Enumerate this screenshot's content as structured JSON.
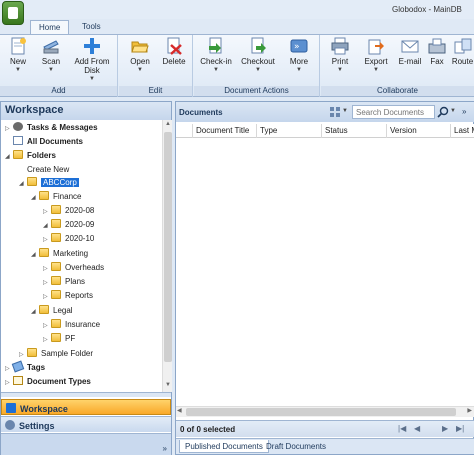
{
  "app": {
    "title": "Globodox - MainDB"
  },
  "tabs": [
    {
      "label": "Home"
    },
    {
      "label": "Tools"
    }
  ],
  "ribbon": {
    "groups": [
      {
        "label": "Add",
        "buttons": [
          {
            "label": "New",
            "icon": "new-document-icon"
          },
          {
            "label": "Scan",
            "icon": "scanner-icon"
          },
          {
            "label": "Add From Disk",
            "icon": "add-plus-icon"
          }
        ]
      },
      {
        "label": "Edit",
        "buttons": [
          {
            "label": "Open",
            "icon": "open-folder-icon"
          },
          {
            "label": "Delete",
            "icon": "delete-icon"
          }
        ]
      },
      {
        "label": "Document Actions",
        "buttons": [
          {
            "label": "Check-in",
            "icon": "check-in-icon"
          },
          {
            "label": "Checkout",
            "icon": "checkout-icon"
          },
          {
            "label": "More",
            "icon": "more-icon"
          }
        ]
      },
      {
        "label": "Collaborate",
        "buttons": [
          {
            "label": "Print",
            "icon": "printer-icon"
          },
          {
            "label": "Export",
            "icon": "export-icon"
          },
          {
            "label": "E-mail",
            "icon": "email-icon"
          },
          {
            "label": "Fax",
            "icon": "fax-icon"
          },
          {
            "label": "Route",
            "icon": "route-icon"
          }
        ]
      }
    ]
  },
  "workspace": {
    "title": "Workspace",
    "tree": {
      "tasks": "Tasks & Messages",
      "all_documents": "All Documents",
      "folders": "Folders",
      "create_new": "Create New",
      "abccorp": "ABCCorp",
      "finance": "Finance",
      "f2020_08": "2020-08",
      "f2020_09": "2020-09",
      "f2020_10": "2020-10",
      "marketing": "Marketing",
      "overheads": "Overheads",
      "plans": "Plans",
      "reports": "Reports",
      "legal": "Legal",
      "insurance": "Insurance",
      "pf": "PF",
      "sample_folder": "Sample Folder",
      "tags": "Tags",
      "document_types": "Document Types"
    },
    "nav": {
      "workspace": "Workspace",
      "settings": "Settings"
    }
  },
  "documents": {
    "title": "Documents",
    "search_placeholder": "Search Documents",
    "columns": [
      "Document Title",
      "Type",
      "Status",
      "Version",
      "Last M"
    ],
    "status": "0 of 0 selected",
    "bottom_tabs": [
      "Published Documents",
      "Draft Documents"
    ]
  }
}
